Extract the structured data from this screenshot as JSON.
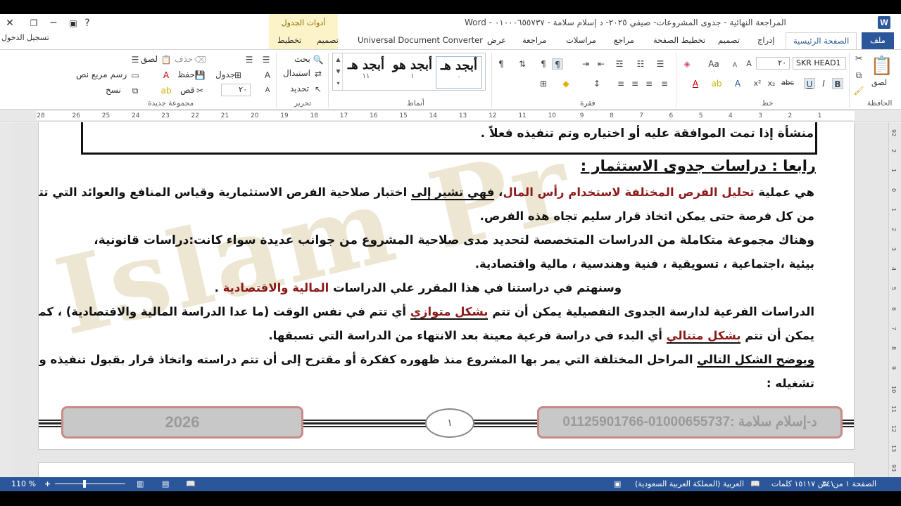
{
  "window": {
    "title": "المراجعة النهائية - جدوى المشروعات- صيفي ٢٠٢٥- د إسلام سلامة - ٠١٠٠٠٦٥٥٧٣٧ - Word",
    "contextual_group": "أدوات الجدول",
    "app_badge": "W",
    "close_glyph": "✕",
    "help_glyph": "?"
  },
  "signin": "تسجيل الدخول",
  "tabs": {
    "file": "ملف",
    "home": "الصفحة الرئيسية",
    "insert": "إدراج",
    "design": "تصميم",
    "layout": "تخطيط الصفحة",
    "references": "مراجع",
    "mailings": "مراسلات",
    "review": "مراجعة",
    "view": "عرض",
    "udc": "Universal Document Converter",
    "table_design": "تصميم",
    "table_layout": "تخطيط"
  },
  "ribbon": {
    "clipboard": {
      "label": "الحافظة",
      "paste": "لصق"
    },
    "font": {
      "label": "خط",
      "name": "SKR HEAD1",
      "size": "٢٠",
      "bold": "B",
      "italic": "I",
      "underline": "U",
      "strike": "abc",
      "subscript": "x₂",
      "superscript": "x²"
    },
    "paragraph": {
      "label": "فقرة"
    },
    "styles": {
      "label": "أنماط",
      "items": [
        {
          "sample": "أبجد هـ",
          "name": "٠"
        },
        {
          "sample": "أبجد هو",
          "name": "١"
        },
        {
          "sample": "أبجد هـ",
          "name": "١١"
        }
      ]
    },
    "editing": {
      "label": "تحرير",
      "find": "بحث",
      "replace": "استبدال",
      "select": "تحديد"
    },
    "new_group": {
      "label": "مجموعة جديدة",
      "paste": "لصق",
      "delete": "حذف",
      "table": "جدول",
      "save": "حفظ",
      "draw_textbox": "رسم مربع نص",
      "cut": "قص",
      "copy": "نسخ",
      "size": "٢٠"
    }
  },
  "ruler": {
    "numbers": [
      "28",
      "26",
      "25",
      "24",
      "23",
      "22",
      "21",
      "20",
      "19",
      "18",
      "17",
      "16",
      "15",
      "14",
      "13",
      "12",
      "11",
      "10",
      "9",
      "8",
      "7",
      "6",
      "5",
      "4",
      "3",
      "2",
      "1"
    ],
    "vertical": [
      "92",
      "2",
      "1",
      "0",
      "1",
      "2",
      "3",
      "4",
      "5",
      "6",
      "7",
      "8",
      "9",
      "10",
      "11",
      "12",
      "13",
      "93"
    ]
  },
  "document": {
    "watermark": "Islam Pr",
    "box_tail": "منشأة إذا تمت الموافقة عليه أو اختياره وتم تنفيذه فعلاً .",
    "heading": "رابعا : دراسات جدوى الاستثمار :",
    "p1a_pre": "هي عملية ",
    "p1a_red": "تحليل الفرص المختلفة لاستخدام رأس المال",
    "p1a_mid": "، ",
    "p1a_ul": "فهي تشير إلى",
    "p1a_post": " اختبار صلاحية الفرص الاستثمارية وقياس المنافع والعوائد التي تتحقق",
    "p1b": "من كل فرصة حتى يمكن اتخاذ قرار سليم تجاه هذه الفرص.",
    "p2a": "وهناك مجموعة متكاملة من الدراسات المتخصصة لتحديد مدى صلاحية المشروع من جوانب عديدة سواء كانت:دراسات قانونية،",
    "p2b": "بيئية ،اجتماعية ، تسويقية ، فنية وهندسية ، مالية واقتصادية.",
    "p3_pre": "وسنهتم في دراستنا في هذا المقرر علي الدراسات ",
    "p3_red": "المالية والاقتصادية",
    "p3_post": " .",
    "p4a_pre": "الدراسات الفرعية لدارسة الجدوى التفصيلية يمكن أن تتم ",
    "p4a_red": "بشكل متوازي",
    "p4a_post": " أي تتم في نفس الوقت (ما عدا الدراسة المالية والاقتصادية) ، كما",
    "p4b_pre": "يمكن أن تتم ",
    "p4b_red": "بشكل متتالي",
    "p4b_post": " أي البدء في دراسة فرعية معينة بعد الانتهاء من الدراسة التي تسبقها.",
    "p5a_ul": "ويوضح الشكل التالي",
    "p5a_post": " المراحل المختلفة التي يمر بها المشروع منذ ظهوره كفكرة أو مقترح إلى أن تتم دراسته واتخاذ قرار بقبول تنفيذه وفي النهاية",
    "p5b": "تشغيله :",
    "footer_left": "2026",
    "footer_page": "١",
    "footer_right": "د-إسلام سلامة :01000655737-01125901766"
  },
  "statusbar": {
    "page": "الصفحة ١ من ٣٤",
    "words": "١ من ١٥١١٧ كلمات",
    "language": "العربية (المملكة العربية السعودية)",
    "zoom": "110 %",
    "plus": "+",
    "minus": "−"
  },
  "colors": {
    "accent": "#2b579a",
    "red_text": "#8b1a1a",
    "footer_border": "#c98a8a"
  }
}
